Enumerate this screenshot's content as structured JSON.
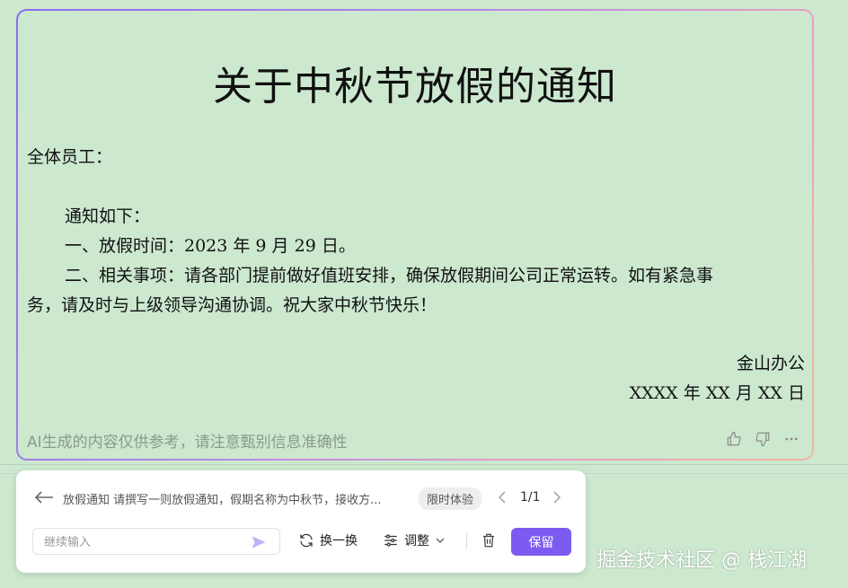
{
  "document": {
    "title": "关于中秋节放假的通知",
    "salutation": "全体员工：",
    "intro": "通知如下：",
    "item1": "一、放假时间：2023 年 9 月 29 日。",
    "item2_line1": "二、相关事项：请各部门提前做好值班安排，确保放假期间公司正常运转。如有紧急事",
    "item2_line2": "务，请及时与上级领导沟通协调。祝大家中秋节快乐！",
    "signature_org": "金山办公",
    "signature_date": "XXXX 年 XX 月 XX 日"
  },
  "disclaimer": "AI生成的内容仅供参考，请注意甄别信息准确性",
  "card_icons": [
    "thumbs-up-icon",
    "thumbs-down-icon",
    "more-icon"
  ],
  "panel": {
    "prompt": "放假通知 请撰写一则放假通知，假期名称为中秋节，接收方...",
    "badge": "限时体验",
    "pager": "1/1",
    "input_placeholder": "继续输入",
    "swap_label": "换一换",
    "adjust_label": "调整",
    "keep_label": "保留"
  },
  "watermark": "掘金技术社区 @ 栈江湖",
  "colors": {
    "background": "#cce8cf",
    "accent": "#7c5cf0"
  }
}
